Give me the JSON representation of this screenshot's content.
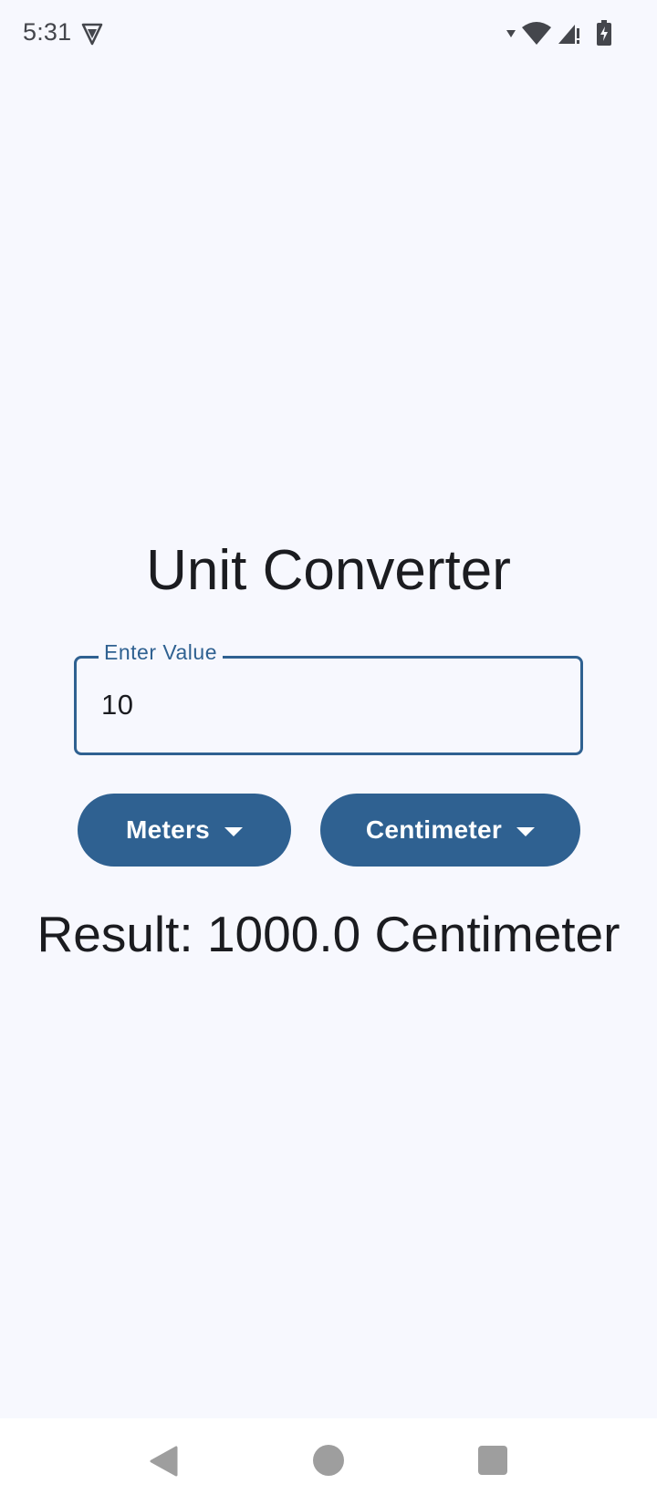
{
  "status_bar": {
    "time": "5:31",
    "left_icons": [
      "vpn-shield-icon"
    ],
    "right_icons": [
      "signal-arrow-icon",
      "wifi-icon",
      "cell-signal-icon",
      "battery-charging-icon"
    ]
  },
  "app": {
    "title": "Unit Converter"
  },
  "input": {
    "label": "Enter Value",
    "value": "10"
  },
  "from_unit": {
    "label": "Meters",
    "icon": "caret-down-icon"
  },
  "to_unit": {
    "label": "Centimeter",
    "icon": "caret-down-icon"
  },
  "result": {
    "text": "Result: 1000.0 Centimeter"
  },
  "nav_bar": {
    "buttons": [
      "back-icon",
      "home-icon",
      "recents-icon"
    ]
  },
  "colors": {
    "background": "#f7f8fe",
    "primary": "#2f6191",
    "on_primary": "#ffffff",
    "text": "#1b1c20",
    "nav_icon": "#9e9e9e"
  }
}
